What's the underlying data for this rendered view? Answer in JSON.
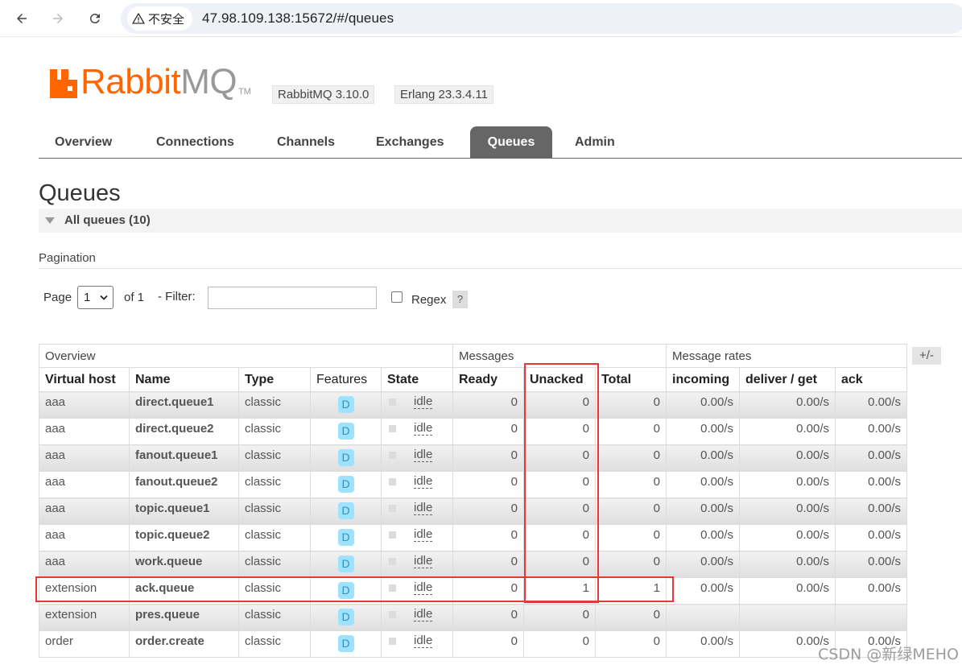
{
  "browser": {
    "security_label": "不安全",
    "url": "47.98.109.138:15672/#/queues"
  },
  "header": {
    "logo_rabbit": "Rabbit",
    "logo_mq": "MQ",
    "logo_tm": "TM",
    "version": "RabbitMQ 3.10.0",
    "erlang": "Erlang 23.3.4.11",
    "brand_color": "#ff6600"
  },
  "tabs": [
    "Overview",
    "Connections",
    "Channels",
    "Exchanges",
    "Queues",
    "Admin"
  ],
  "active_tab": "Queues",
  "page": {
    "title": "Queues",
    "section": "All queues (10)",
    "pagination_title": "Pagination",
    "page_label": "Page",
    "page_value": "1",
    "of_label": "of 1",
    "filter_label": "- Filter:",
    "filter_value": "",
    "regex_label": "Regex",
    "help_label": "?",
    "toggle_columns": "+/-"
  },
  "table": {
    "groups": [
      "Overview",
      "Messages",
      "Message rates"
    ],
    "columns": [
      "Virtual host",
      "Name",
      "Type",
      "Features",
      "State",
      "Ready",
      "Unacked",
      "Total",
      "incoming",
      "deliver / get",
      "ack"
    ],
    "rows": [
      {
        "vhost": "aaa",
        "name": "direct.queue1",
        "type": "classic",
        "feature": "D",
        "state": "idle",
        "ready": "0",
        "unacked": "0",
        "total": "0",
        "incoming": "0.00/s",
        "deliver": "0.00/s",
        "ack": "0.00/s"
      },
      {
        "vhost": "aaa",
        "name": "direct.queue2",
        "type": "classic",
        "feature": "D",
        "state": "idle",
        "ready": "0",
        "unacked": "0",
        "total": "0",
        "incoming": "0.00/s",
        "deliver": "0.00/s",
        "ack": "0.00/s"
      },
      {
        "vhost": "aaa",
        "name": "fanout.queue1",
        "type": "classic",
        "feature": "D",
        "state": "idle",
        "ready": "0",
        "unacked": "0",
        "total": "0",
        "incoming": "0.00/s",
        "deliver": "0.00/s",
        "ack": "0.00/s"
      },
      {
        "vhost": "aaa",
        "name": "fanout.queue2",
        "type": "classic",
        "feature": "D",
        "state": "idle",
        "ready": "0",
        "unacked": "0",
        "total": "0",
        "incoming": "0.00/s",
        "deliver": "0.00/s",
        "ack": "0.00/s"
      },
      {
        "vhost": "aaa",
        "name": "topic.queue1",
        "type": "classic",
        "feature": "D",
        "state": "idle",
        "ready": "0",
        "unacked": "0",
        "total": "0",
        "incoming": "0.00/s",
        "deliver": "0.00/s",
        "ack": "0.00/s"
      },
      {
        "vhost": "aaa",
        "name": "topic.queue2",
        "type": "classic",
        "feature": "D",
        "state": "idle",
        "ready": "0",
        "unacked": "0",
        "total": "0",
        "incoming": "0.00/s",
        "deliver": "0.00/s",
        "ack": "0.00/s"
      },
      {
        "vhost": "aaa",
        "name": "work.queue",
        "type": "classic",
        "feature": "D",
        "state": "idle",
        "ready": "0",
        "unacked": "0",
        "total": "0",
        "incoming": "0.00/s",
        "deliver": "0.00/s",
        "ack": "0.00/s"
      },
      {
        "vhost": "extension",
        "name": "ack.queue",
        "type": "classic",
        "feature": "D",
        "state": "idle",
        "ready": "0",
        "unacked": "1",
        "total": "1",
        "incoming": "0.00/s",
        "deliver": "0.00/s",
        "ack": "0.00/s"
      },
      {
        "vhost": "extension",
        "name": "pres.queue",
        "type": "classic",
        "feature": "D",
        "state": "idle",
        "ready": "0",
        "unacked": "0",
        "total": "0",
        "incoming": "",
        "deliver": "",
        "ack": ""
      },
      {
        "vhost": "order",
        "name": "order.create",
        "type": "classic",
        "feature": "D",
        "state": "idle",
        "ready": "0",
        "unacked": "0",
        "total": "0",
        "incoming": "0.00/s",
        "deliver": "0.00/s",
        "ack": "0.00/s"
      }
    ]
  },
  "highlight_color": "#e53935",
  "watermark": "CSDN @新绿MEHO"
}
